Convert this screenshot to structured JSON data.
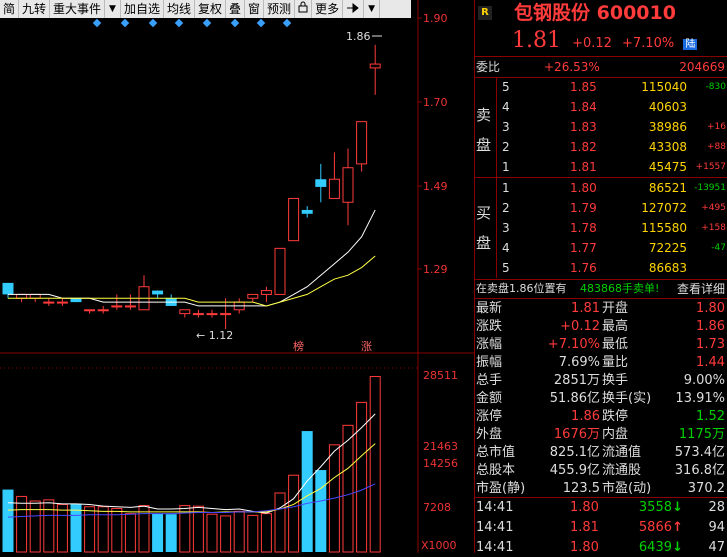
{
  "toolbar": {
    "items": [
      "简",
      "九转",
      "重大事件",
      "加自选",
      "均线",
      "复权",
      "叠",
      "窗",
      "预测",
      "更多"
    ],
    "menu_arrow": "▼",
    "lock_icon": "lock-icon",
    "pin_icon": "pin-icon"
  },
  "price_axis": {
    "labels": [
      "1.90",
      "1.70",
      "1.49",
      "1.29"
    ]
  },
  "volume_axis": {
    "labels": [
      "28511",
      "21463",
      "14256",
      "7208"
    ],
    "unit": "X1000"
  },
  "chart_annotations": {
    "high_label": "1.86",
    "low_label": "1.12",
    "tag_bang": "榜",
    "tag_zhang": "涨"
  },
  "colors": {
    "up": "#ff3b3b",
    "down": "#33ccff",
    "ma_white": "#ffffff",
    "ma_yellow": "#ffff44",
    "ma_purple": "#4848ff",
    "grid": "#8a0000"
  },
  "chart_data": {
    "type": "candlestick",
    "price_ylim": [
      1.06,
      1.93
    ],
    "candles": [
      {
        "o": 1.24,
        "h": 1.24,
        "l": 1.2,
        "c": 1.21
      },
      {
        "o": 1.2,
        "h": 1.21,
        "l": 1.19,
        "c": 1.21
      },
      {
        "o": 1.2,
        "h": 1.21,
        "l": 1.19,
        "c": 1.21
      },
      {
        "o": 1.19,
        "h": 1.2,
        "l": 1.18,
        "c": 1.19
      },
      {
        "o": 1.19,
        "h": 1.2,
        "l": 1.18,
        "c": 1.19
      },
      {
        "o": 1.2,
        "h": 1.2,
        "l": 1.19,
        "c": 1.19
      },
      {
        "o": 1.17,
        "h": 1.17,
        "l": 1.16,
        "c": 1.17
      },
      {
        "o": 1.17,
        "h": 1.18,
        "l": 1.16,
        "c": 1.17
      },
      {
        "o": 1.18,
        "h": 1.21,
        "l": 1.17,
        "c": 1.18
      },
      {
        "o": 1.18,
        "h": 1.21,
        "l": 1.17,
        "c": 1.18
      },
      {
        "o": 1.17,
        "h": 1.26,
        "l": 1.17,
        "c": 1.23
      },
      {
        "o": 1.22,
        "h": 1.22,
        "l": 1.2,
        "c": 1.21
      },
      {
        "o": 1.2,
        "h": 1.21,
        "l": 1.18,
        "c": 1.18
      },
      {
        "o": 1.16,
        "h": 1.17,
        "l": 1.15,
        "c": 1.17
      },
      {
        "o": 1.16,
        "h": 1.17,
        "l": 1.15,
        "c": 1.16
      },
      {
        "o": 1.16,
        "h": 1.17,
        "l": 1.15,
        "c": 1.16
      },
      {
        "o": 1.16,
        "h": 1.2,
        "l": 1.12,
        "c": 1.16
      },
      {
        "o": 1.17,
        "h": 1.2,
        "l": 1.16,
        "c": 1.19
      },
      {
        "o": 1.2,
        "h": 1.21,
        "l": 1.19,
        "c": 1.21
      },
      {
        "o": 1.21,
        "h": 1.23,
        "l": 1.19,
        "c": 1.22
      },
      {
        "o": 1.21,
        "h": 1.33,
        "l": 1.21,
        "c": 1.33
      },
      {
        "o": 1.35,
        "h": 1.46,
        "l": 1.35,
        "c": 1.46
      },
      {
        "o": 1.43,
        "h": 1.44,
        "l": 1.41,
        "c": 1.42
      },
      {
        "o": 1.51,
        "h": 1.55,
        "l": 1.45,
        "c": 1.49
      },
      {
        "o": 1.46,
        "h": 1.58,
        "l": 1.46,
        "c": 1.51
      },
      {
        "o": 1.45,
        "h": 1.59,
        "l": 1.39,
        "c": 1.54
      },
      {
        "o": 1.55,
        "h": 1.66,
        "l": 1.53,
        "c": 1.66
      },
      {
        "o": 1.8,
        "h": 1.86,
        "l": 1.73,
        "c": 1.81
      }
    ],
    "ma_white": [
      1.21,
      1.21,
      1.21,
      1.21,
      1.2,
      1.2,
      1.2,
      1.19,
      1.19,
      1.19,
      1.19,
      1.19,
      1.19,
      1.19,
      1.18,
      1.18,
      1.18,
      1.18,
      1.18,
      1.18,
      1.19,
      1.21,
      1.23,
      1.26,
      1.29,
      1.32,
      1.36,
      1.43
    ],
    "ma_yellow": [
      1.2,
      1.2,
      1.2,
      1.2,
      1.2,
      1.2,
      1.2,
      1.2,
      1.2,
      1.2,
      1.2,
      1.2,
      1.2,
      1.2,
      1.19,
      1.19,
      1.19,
      1.19,
      1.19,
      1.18,
      1.19,
      1.2,
      1.21,
      1.23,
      1.25,
      1.26,
      1.28,
      1.31
    ],
    "vol_ylim": [
      0,
      30000
    ],
    "volume": [
      8800,
      7600,
      6800,
      7000,
      6200,
      6300,
      5800,
      5800,
      5500,
      4600,
      6000,
      4600,
      4500,
      6000,
      5900,
      4500,
      4200,
      5000,
      4300,
      4600,
      8200,
      11300,
      19000,
      12200,
      16600,
      20000,
      24000,
      28511
    ],
    "vol_ma_white": [
      6500,
      6400,
      6400,
      6500,
      6300,
      6300,
      6200,
      5900,
      5800,
      5700,
      5900,
      5400,
      5400,
      5500,
      5700,
      5500,
      5300,
      5400,
      5000,
      4700,
      5600,
      7200,
      10300,
      12800,
      15500,
      17400,
      19600,
      22000
    ],
    "vol_ma_yellow": [
      5200,
      5300,
      5300,
      5300,
      5200,
      5200,
      5100,
      5000,
      5000,
      4900,
      4900,
      4900,
      4900,
      4900,
      4900,
      4800,
      4900,
      4900,
      4900,
      4900,
      5400,
      6200,
      7700,
      9000,
      10900,
      12500,
      14700,
      16800
    ],
    "vol_ma_purple": [
      4000,
      4100,
      4200,
      4300,
      4300,
      4300,
      4400,
      4400,
      4400,
      4500,
      4600,
      4600,
      4600,
      4700,
      4800,
      4800,
      4800,
      4900,
      4900,
      5100,
      5400,
      5800,
      6400,
      6800,
      7300,
      7900,
      8700,
      9800
    ]
  },
  "quote": {
    "r_tag": "R",
    "name": "包钢股份",
    "code": "600010",
    "price": "1.81",
    "change": "+0.12",
    "change_pct": "+7.10%",
    "exchange_tag": "陆",
    "weibi_label": "委比",
    "weibi_pct": "+26.53%",
    "weibi_val": "204669",
    "sell_label": [
      "卖",
      "盘"
    ],
    "buy_label": [
      "买",
      "盘"
    ],
    "sell": [
      {
        "lvl": "5",
        "price": "1.85",
        "vol": "115040",
        "chg": "-830"
      },
      {
        "lvl": "4",
        "price": "1.84",
        "vol": "40603",
        "chg": ""
      },
      {
        "lvl": "3",
        "price": "1.83",
        "vol": "38986",
        "chg": "+16"
      },
      {
        "lvl": "2",
        "price": "1.82",
        "vol": "43308",
        "chg": "+88"
      },
      {
        "lvl": "1",
        "price": "1.81",
        "vol": "45475",
        "chg": "+1557"
      }
    ],
    "buy": [
      {
        "lvl": "1",
        "price": "1.80",
        "vol": "86521",
        "chg": "-13951"
      },
      {
        "lvl": "2",
        "price": "1.79",
        "vol": "127072",
        "chg": "+495"
      },
      {
        "lvl": "3",
        "price": "1.78",
        "vol": "115580",
        "chg": "+158"
      },
      {
        "lvl": "4",
        "price": "1.77",
        "vol": "72225",
        "chg": "-47"
      },
      {
        "lvl": "5",
        "price": "1.76",
        "vol": "86683",
        "chg": ""
      }
    ],
    "notice_a": "在卖盘1.86位置有",
    "notice_b": "483868手卖单!",
    "notice_link": "查看详细",
    "stats": [
      {
        "l1": "最新",
        "v1": "1.81",
        "c1": "red",
        "l2": "开盘",
        "v2": "1.80",
        "c2": "red"
      },
      {
        "l1": "涨跌",
        "v1": "+0.12",
        "c1": "red",
        "l2": "最高",
        "v2": "1.86",
        "c2": "red"
      },
      {
        "l1": "涨幅",
        "v1": "+7.10%",
        "c1": "red",
        "l2": "最低",
        "v2": "1.73",
        "c2": "red"
      },
      {
        "l1": "振幅",
        "v1": "7.69%",
        "c1": "white",
        "l2": "量比",
        "v2": "1.44",
        "c2": "red"
      },
      {
        "l1": "总手",
        "v1": "2851万",
        "c1": "white",
        "l2": "换手",
        "v2": "9.00%",
        "c2": "white"
      },
      {
        "l1": "金额",
        "v1": "51.86亿",
        "c1": "white",
        "l2": "换手(实)",
        "v2": "13.91%",
        "c2": "white"
      },
      {
        "l1": "涨停",
        "v1": "1.86",
        "c1": "red",
        "l2": "跌停",
        "v2": "1.52",
        "c2": "green"
      },
      {
        "l1": "外盘",
        "v1": "1676万",
        "c1": "red",
        "l2": "内盘",
        "v2": "1175万",
        "c2": "green"
      },
      {
        "l1": "总市值",
        "v1": "825.1亿",
        "c1": "white",
        "l2": "流通值",
        "v2": "573.4亿",
        "c2": "white"
      },
      {
        "l1": "总股本",
        "v1": "455.9亿",
        "c1": "white",
        "l2": "流通股",
        "v2": "316.8亿",
        "c2": "white"
      },
      {
        "l1": "市盈(静)",
        "v1": "123.5",
        "c1": "white",
        "l2": "市盈(动)",
        "v2": "370.2",
        "c2": "white"
      }
    ],
    "ticks": [
      {
        "time": "14:41",
        "price": "1.80",
        "pc": "red",
        "vol": "3558",
        "vc": "green",
        "arrow": "↓",
        "ac": "green",
        "n": "28"
      },
      {
        "time": "14:41",
        "price": "1.81",
        "pc": "red",
        "vol": "5866",
        "vc": "red",
        "arrow": "↑",
        "ac": "red",
        "n": "94"
      },
      {
        "time": "14:41",
        "price": "1.80",
        "pc": "red",
        "vol": "6439",
        "vc": "green",
        "arrow": "↓",
        "ac": "green",
        "n": "47"
      }
    ]
  }
}
